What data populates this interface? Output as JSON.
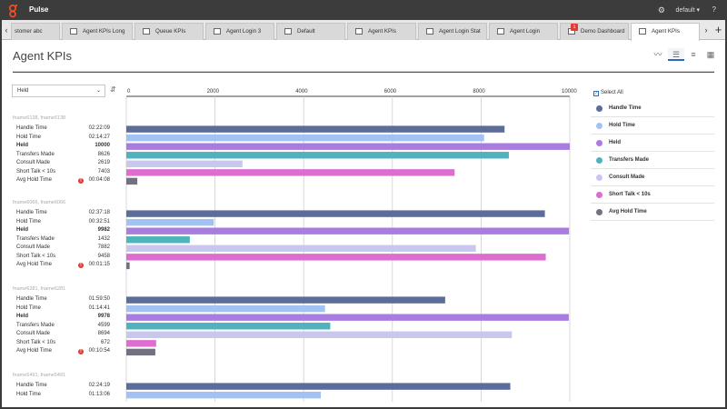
{
  "app": {
    "title": "Pulse",
    "user": "default ▾",
    "help": "?"
  },
  "tabs": [
    {
      "label": "stomer abc"
    },
    {
      "label": "Agent KPIs Long"
    },
    {
      "label": "Queue KPIs"
    },
    {
      "label": "Agent Login 3"
    },
    {
      "label": "Default"
    },
    {
      "label": "Agent KPIs"
    },
    {
      "label": "Agent Login Stat"
    },
    {
      "label": "Agent Login"
    },
    {
      "label": "Demo Dashboard",
      "badge": "1"
    },
    {
      "label": "Agent KPIs",
      "active": true
    }
  ],
  "page": {
    "title": "Agent KPIs"
  },
  "metric_select": {
    "value": "Held"
  },
  "chart_data": {
    "type": "bar",
    "orientation": "horizontal",
    "x_ticks": [
      "0",
      "2000",
      "4000",
      "6000",
      "8000",
      "10000"
    ],
    "xlim": [
      0,
      10000
    ],
    "grid": true,
    "legend_placement": "right",
    "series": [
      {
        "name": "Handle Time",
        "color": "#5d6d9a"
      },
      {
        "name": "Hold Time",
        "color": "#a3c2f4"
      },
      {
        "name": "Held",
        "color": "#a97de0"
      },
      {
        "name": "Transfers Made",
        "color": "#4fb3bd"
      },
      {
        "name": "Consult Made",
        "color": "#c9c7ee"
      },
      {
        "name": "Short Talk < 10s",
        "color": "#dd6dcf"
      },
      {
        "name": "Avg Hold Time",
        "color": "#73717f"
      }
    ],
    "groups": [
      {
        "title": "fname6138, fname6138",
        "rows": [
          {
            "label": "Handle Time",
            "display": "02:22:09",
            "value": 8529
          },
          {
            "label": "Hold Time",
            "display": "02:14:27",
            "value": 8067
          },
          {
            "label": "Held",
            "display": "10000",
            "value": 10000,
            "bold": true
          },
          {
            "label": "Transfers Made",
            "display": "8626",
            "value": 8626
          },
          {
            "label": "Consult Made",
            "display": "2619",
            "value": 2619
          },
          {
            "label": "Short Talk < 10s",
            "display": "7403",
            "value": 7403
          },
          {
            "label": "Avg Hold Time",
            "display": "00:04:08",
            "value": 248,
            "alert": true
          }
        ]
      },
      {
        "title": "fname6066, fname6066",
        "rows": [
          {
            "label": "Handle Time",
            "display": "02:37:18",
            "value": 9438
          },
          {
            "label": "Hold Time",
            "display": "00:32:51",
            "value": 1971
          },
          {
            "label": "Held",
            "display": "9982",
            "value": 9982,
            "bold": true
          },
          {
            "label": "Transfers Made",
            "display": "1432",
            "value": 1432
          },
          {
            "label": "Consult Made",
            "display": "7882",
            "value": 7882
          },
          {
            "label": "Short Talk < 10s",
            "display": "9458",
            "value": 9458
          },
          {
            "label": "Avg Hold Time",
            "display": "00:01:15",
            "value": 75,
            "alert": true
          }
        ]
      },
      {
        "title": "fname6281, fname6281",
        "rows": [
          {
            "label": "Handle Time",
            "display": "01:59:50",
            "value": 7190
          },
          {
            "label": "Hold Time",
            "display": "01:14:41",
            "value": 4481
          },
          {
            "label": "Held",
            "display": "9978",
            "value": 9978,
            "bold": true
          },
          {
            "label": "Transfers Made",
            "display": "4599",
            "value": 4599
          },
          {
            "label": "Consult Made",
            "display": "8694",
            "value": 8694
          },
          {
            "label": "Short Talk < 10s",
            "display": "672",
            "value": 672
          },
          {
            "label": "Avg Hold Time",
            "display": "00:10:54",
            "value": 654,
            "alert": true
          }
        ]
      },
      {
        "title": "fname5491, fname5491",
        "rows": [
          {
            "label": "Handle Time",
            "display": "02:24:19",
            "value": 8659
          },
          {
            "label": "Hold Time",
            "display": "01:13:06",
            "value": 4386
          }
        ]
      }
    ]
  },
  "legend": {
    "select_all_label": "Select All"
  }
}
